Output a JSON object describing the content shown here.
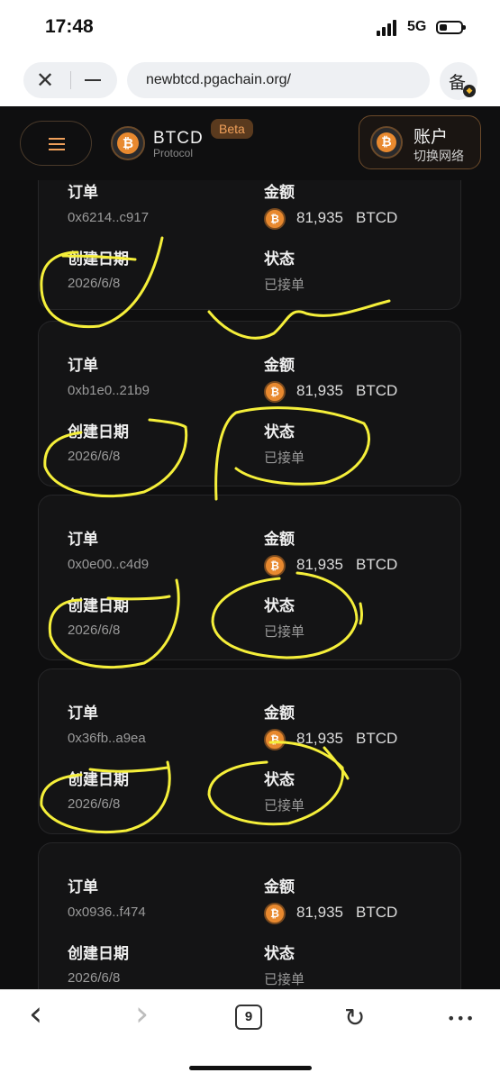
{
  "status_bar": {
    "time": "17:48",
    "network": "5G",
    "battery_level": 0.3
  },
  "browser": {
    "url": "newbtcd.pgachain.org/",
    "close_icon": "close-icon",
    "minimize_icon": "minimize-icon",
    "beian_label": "备",
    "tab_count": "9"
  },
  "header": {
    "brand": "BTCD",
    "brand_sub": "Protocol",
    "beta": "Beta",
    "account_title": "账户",
    "account_sub": "切换网络",
    "accent": "#e8892f"
  },
  "labels": {
    "order": "订单",
    "amount": "金额",
    "created": "创建日期",
    "status": "状态"
  },
  "orders": [
    {
      "id": "0x6214..c917",
      "amount": "81,935",
      "unit": "BTCD",
      "date": "2026/6/8",
      "status": "已接单"
    },
    {
      "id": "0xb1e0..21b9",
      "amount": "81,935",
      "unit": "BTCD",
      "date": "2026/6/8",
      "status": "已接单"
    },
    {
      "id": "0x0e00..c4d9",
      "amount": "81,935",
      "unit": "BTCD",
      "date": "2026/6/8",
      "status": "已接单"
    },
    {
      "id": "0x36fb..a9ea",
      "amount": "81,935",
      "unit": "BTCD",
      "date": "2026/6/8",
      "status": "已接单"
    },
    {
      "id": "0x0936..f474",
      "amount": "81,935",
      "unit": "BTCD",
      "date": "2026/6/8",
      "status": "已接单"
    }
  ],
  "toolbar": {
    "back": "‹",
    "forward": "›",
    "reload": "↻",
    "more": "•••"
  }
}
